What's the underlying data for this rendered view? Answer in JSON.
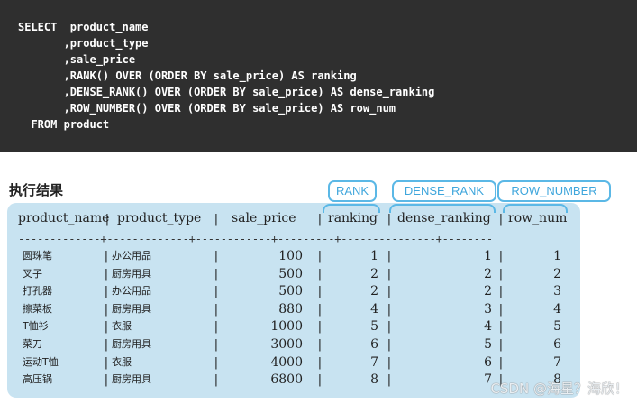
{
  "sql": {
    "lines": [
      "SELECT  product_name",
      "       ,product_type",
      "       ,sale_price",
      "       ,RANK() OVER (ORDER BY sale_price) AS ranking",
      "       ,DENSE_RANK() OVER (ORDER BY sale_price) AS dense_ranking",
      "       ,ROW_NUMBER() OVER (ORDER BY sale_price) AS row_num",
      "  FROM product"
    ]
  },
  "result": {
    "title": "执行结果",
    "tags": {
      "rank": "RANK",
      "dense_rank": "DENSE_RANK",
      "row_number": "ROW_NUMBER"
    },
    "headers": {
      "product_name": "product_name",
      "product_type": "product_type",
      "sale_price": "sale_price",
      "ranking": "ranking",
      "dense_ranking": "dense_ranking",
      "row_num": "row_num"
    },
    "separator": "-------------+-------------+------------+---------+---------------+--------",
    "rows": [
      {
        "product_name": "圆珠笔",
        "product_type": "办公用品",
        "sale_price": "100",
        "ranking": "1",
        "dense_ranking": "1",
        "row_num": "1"
      },
      {
        "product_name": "叉子",
        "product_type": "厨房用具",
        "sale_price": "500",
        "ranking": "2",
        "dense_ranking": "2",
        "row_num": "2"
      },
      {
        "product_name": "打孔器",
        "product_type": "办公用品",
        "sale_price": "500",
        "ranking": "2",
        "dense_ranking": "2",
        "row_num": "3"
      },
      {
        "product_name": "擦菜板",
        "product_type": "厨房用具",
        "sale_price": "880",
        "ranking": "4",
        "dense_ranking": "3",
        "row_num": "4"
      },
      {
        "product_name": "T恤衫",
        "product_type": "衣服",
        "sale_price": "1000",
        "ranking": "5",
        "dense_ranking": "4",
        "row_num": "5"
      },
      {
        "product_name": "菜刀",
        "product_type": "厨房用具",
        "sale_price": "3000",
        "ranking": "6",
        "dense_ranking": "5",
        "row_num": "6"
      },
      {
        "product_name": "运动T恤",
        "product_type": "衣服",
        "sale_price": "4000",
        "ranking": "7",
        "dense_ranking": "6",
        "row_num": "7"
      },
      {
        "product_name": "高压锅",
        "product_type": "厨房用具",
        "sale_price": "6800",
        "ranking": "8",
        "dense_ranking": "7",
        "row_num": "8"
      }
    ]
  },
  "watermark": "CSDN @海星？海欣！"
}
